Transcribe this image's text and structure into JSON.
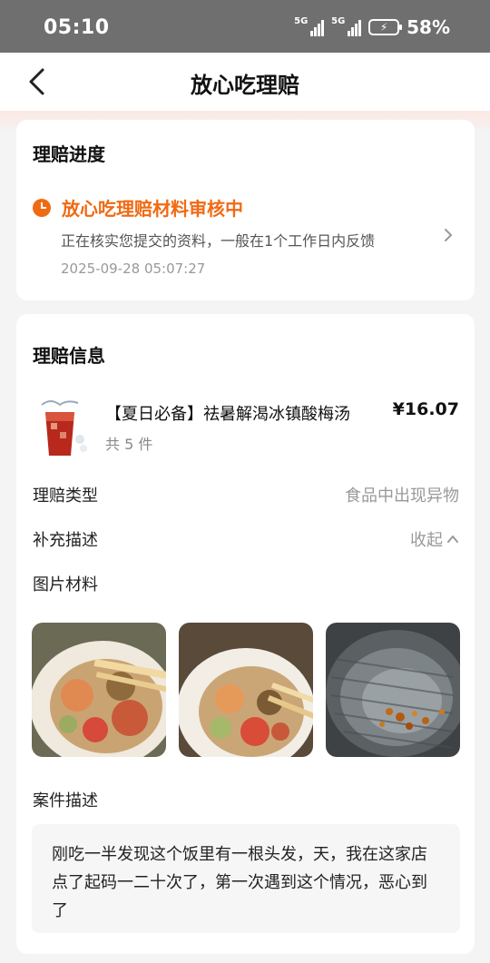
{
  "status_bar": {
    "time": "05:10",
    "network1": "5G",
    "network2": "5G",
    "battery": "58%"
  },
  "header": {
    "title": "放心吃理赔"
  },
  "progress": {
    "title": "理赔进度",
    "status": "放心吃理赔材料审核中",
    "description": "正在核实您提交的资料，一般在1个工作日内反馈",
    "timestamp": "2025-09-28 05:07:27",
    "accent_color": "#f06a14"
  },
  "claim": {
    "title": "理赔信息",
    "product": {
      "name": "【夏日必备】祛暑解渴冰镇酸梅汤",
      "quantity": "共 5 件",
      "price": "¥16.07"
    },
    "claim_type_label": "理赔类型",
    "claim_type_value": "食品中出现异物",
    "supplement_label": "补充描述",
    "supplement_action": "收起",
    "photos_label": "图片材料",
    "case_label": "案件描述",
    "case_text": "刚吃一半发现这个饭里有一根头发，天，我在这家店点了起码一二十次了，第一次遇到这个情况，恶心到了"
  }
}
